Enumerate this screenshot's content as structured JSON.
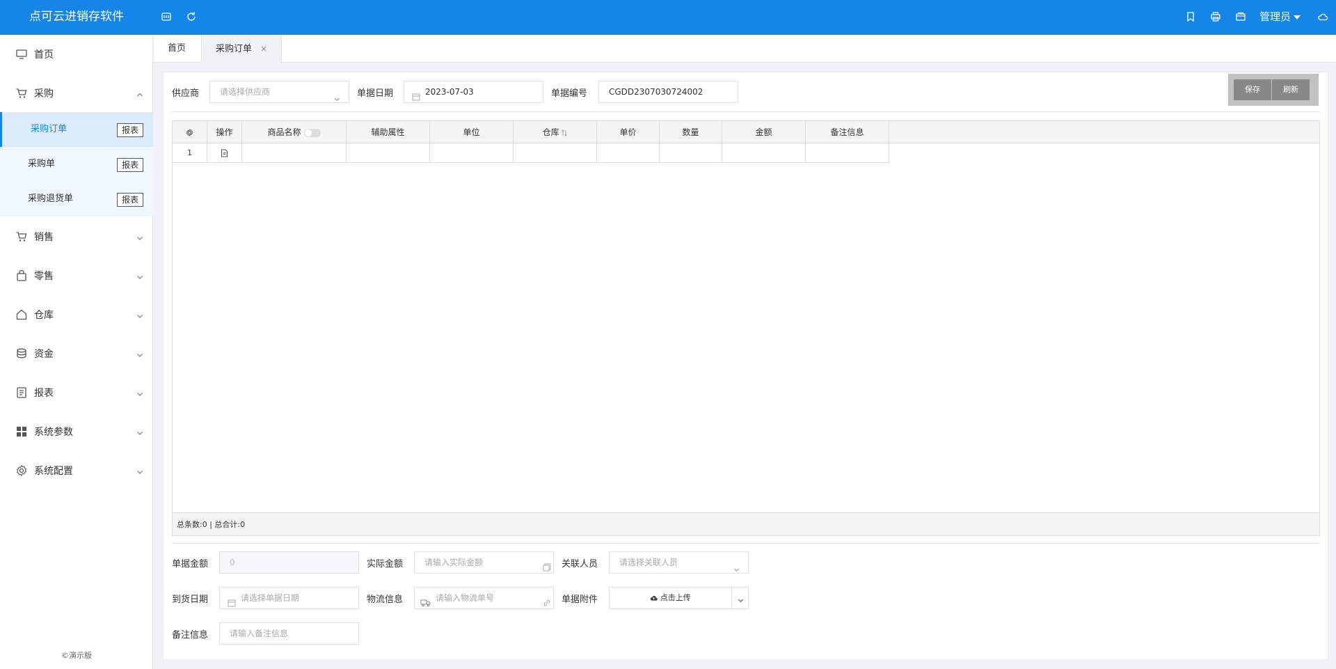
{
  "app": {
    "title": "点可云进销存软件",
    "admin": "管理员"
  },
  "sidebar": {
    "home": "首页",
    "purchase": "采购",
    "purchase_items": [
      {
        "label": "采购订单",
        "report": "报表"
      },
      {
        "label": "采购单",
        "report": "报表"
      },
      {
        "label": "采购退货单",
        "report": "报表"
      }
    ],
    "sales": "销售",
    "retail": "零售",
    "warehouse": "仓库",
    "funds": "资金",
    "reports": "报表",
    "system_params": "系统参数",
    "system_config": "系统配置",
    "demo": "©演示版"
  },
  "tabs": {
    "home": "首页",
    "current": "采购订单",
    "close": "×"
  },
  "form": {
    "supplier_label": "供应商",
    "supplier_placeholder": "请选择供应商",
    "date_label": "单据日期",
    "date_value": "2023-07-03",
    "number_label": "单据编号",
    "number_value": "CGDD2307030724002",
    "save": "保存",
    "refresh": "刷新"
  },
  "grid": {
    "columns": [
      "操作",
      "商品名称",
      "辅助属性",
      "单位",
      "仓库",
      "单价",
      "数量",
      "金额",
      "备注信息"
    ],
    "row_index": "1",
    "footer": "总条数:0 | 总合计:0"
  },
  "bottom": {
    "amount_label": "单据金额",
    "amount_value": "0",
    "actual_label": "实际金额",
    "actual_placeholder": "请输入实际金额",
    "people_label": "关联人员",
    "people_placeholder": "请选择关联人员",
    "arrival_label": "到货日期",
    "arrival_placeholder": "请选择单据日期",
    "logistics_label": "物流信息",
    "logistics_placeholder": "请输入物流单号",
    "attachment_label": "单据附件",
    "upload": "点击上传",
    "remark_label": "备注信息",
    "remark_placeholder": "请输入备注信息"
  }
}
